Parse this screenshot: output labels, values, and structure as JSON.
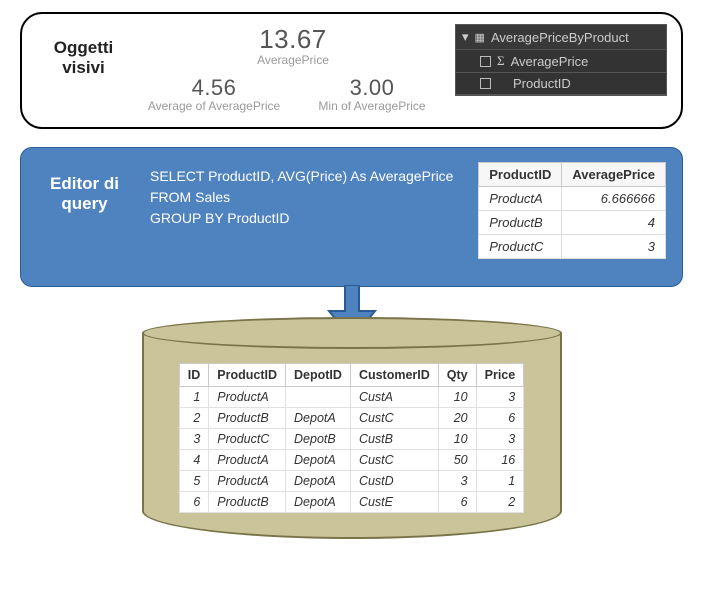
{
  "visuals": {
    "panel_label": "Oggetti visivi",
    "kpis": {
      "big_val": "13.67",
      "big_cap": "AveragePrice",
      "avg_val": "4.56",
      "avg_cap": "Average of AveragePrice",
      "min_val": "3.00",
      "min_cap": "Min of AveragePrice"
    },
    "fields": {
      "table_name": "AveragePriceByProduct",
      "field1": "AveragePrice",
      "field2": "ProductID"
    }
  },
  "query": {
    "panel_label": "Editor di query",
    "sql": "SELECT ProductID, AVG(Price) As AveragePrice\nFROM Sales\nGROUP BY ProductID",
    "result_headers": {
      "c1": "ProductID",
      "c2": "AveragePrice"
    },
    "result_rows": [
      {
        "pid": "ProductA",
        "avg": "6.666666"
      },
      {
        "pid": "ProductB",
        "avg": "4"
      },
      {
        "pid": "ProductC",
        "avg": "3"
      }
    ]
  },
  "db": {
    "headers": {
      "id": "ID",
      "pid": "ProductID",
      "did": "DepotID",
      "cid": "CustomerID",
      "qty": "Qty",
      "price": "Price"
    },
    "rows": [
      {
        "id": "1",
        "pid": "ProductA",
        "did": "",
        "cid": "CustA",
        "qty": "10",
        "price": "3"
      },
      {
        "id": "2",
        "pid": "ProductB",
        "did": "DepotA",
        "cid": "CustC",
        "qty": "20",
        "price": "6"
      },
      {
        "id": "3",
        "pid": "ProductC",
        "did": "DepotB",
        "cid": "CustB",
        "qty": "10",
        "price": "3"
      },
      {
        "id": "4",
        "pid": "ProductA",
        "did": "DepotA",
        "cid": "CustC",
        "qty": "50",
        "price": "16"
      },
      {
        "id": "5",
        "pid": "ProductA",
        "did": "DepotA",
        "cid": "CustD",
        "qty": "3",
        "price": "1"
      },
      {
        "id": "6",
        "pid": "ProductB",
        "did": "DepotA",
        "cid": "CustE",
        "qty": "6",
        "price": "2"
      }
    ]
  },
  "chart_data": {
    "type": "table",
    "title": "Sales aggregation pipeline",
    "source_table": {
      "name": "Sales",
      "columns": [
        "ID",
        "ProductID",
        "DepotID",
        "CustomerID",
        "Qty",
        "Price"
      ],
      "rows": [
        [
          1,
          "ProductA",
          null,
          "CustA",
          10,
          3
        ],
        [
          2,
          "ProductB",
          "DepotA",
          "CustC",
          20,
          6
        ],
        [
          3,
          "ProductC",
          "DepotB",
          "CustB",
          10,
          3
        ],
        [
          4,
          "ProductA",
          "DepotA",
          "CustC",
          50,
          16
        ],
        [
          5,
          "ProductA",
          "DepotA",
          "CustD",
          3,
          1
        ],
        [
          6,
          "ProductB",
          "DepotA",
          "CustE",
          6,
          2
        ]
      ]
    },
    "aggregated_table": {
      "query": "SELECT ProductID, AVG(Price) As AveragePrice FROM Sales GROUP BY ProductID",
      "columns": [
        "ProductID",
        "AveragePrice"
      ],
      "rows": [
        [
          "ProductA",
          6.666666
        ],
        [
          "ProductB",
          4
        ],
        [
          "ProductC",
          3
        ]
      ]
    },
    "kpi_cards": [
      {
        "metric": "AveragePrice (sum)",
        "value": 13.67
      },
      {
        "metric": "Average of AveragePrice",
        "value": 4.56
      },
      {
        "metric": "Min of AveragePrice",
        "value": 3.0
      }
    ]
  }
}
